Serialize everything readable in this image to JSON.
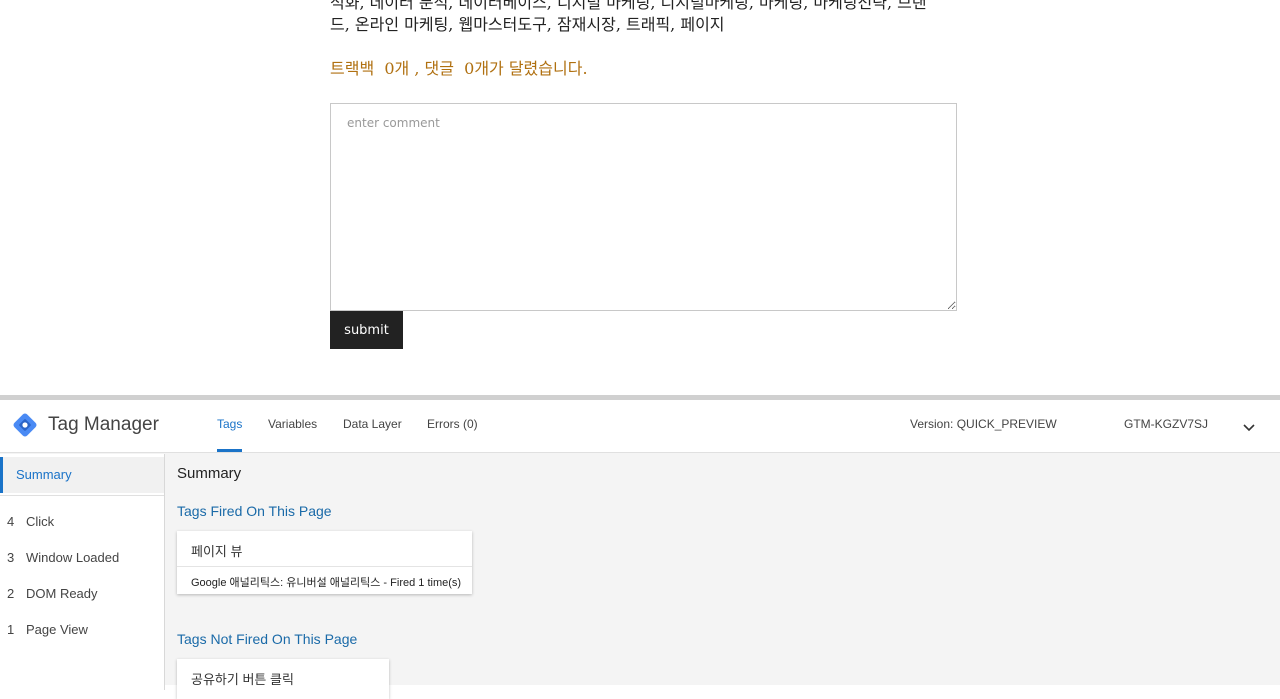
{
  "blog": {
    "tags_line1": "석화, 데이터 분석, 데이터베이스, 디지털 마케팅, 디지털마케팅, 마케팅, 마케팅전략, 브랜",
    "tags_line2": "드, 온라인 마케팅, 웹마스터도구, 잠재시장, 트래픽, 페이지",
    "trackback_label": "트랙백",
    "trackback_count": "0",
    "comment_label": "개 , 댓글",
    "comment_count": "0",
    "count_suffix": "개가 달렸습니다.",
    "comment_placeholder": "enter comment",
    "submit_label": "submit"
  },
  "gtm": {
    "brand": "Tag Manager",
    "tabs": [
      {
        "label": "Tags",
        "active": true
      },
      {
        "label": "Variables",
        "active": false
      },
      {
        "label": "Data Layer",
        "active": false
      },
      {
        "label": "Errors (0)",
        "active": false
      }
    ],
    "version": "Version: QUICK_PREVIEW",
    "container_id": "GTM-KGZV7SJ",
    "accent_color": "#1a73c8",
    "sidebar": {
      "summary_label": "Summary",
      "events": [
        {
          "num": "4",
          "label": "Click"
        },
        {
          "num": "3",
          "label": "Window Loaded"
        },
        {
          "num": "2",
          "label": "DOM Ready"
        },
        {
          "num": "1",
          "label": "Page View"
        }
      ]
    },
    "main": {
      "title": "Summary",
      "fired_title": "Tags Fired On This Page",
      "fired_tags": [
        {
          "name": "페이지 뷰",
          "detail": "Google 애널리틱스: 유니버설 애널리틱스 - Fired 1 time(s)"
        }
      ],
      "not_fired_title": "Tags Not Fired On This Page",
      "not_fired_tags": [
        {
          "name": "공유하기 버튼 클릭"
        }
      ]
    }
  }
}
